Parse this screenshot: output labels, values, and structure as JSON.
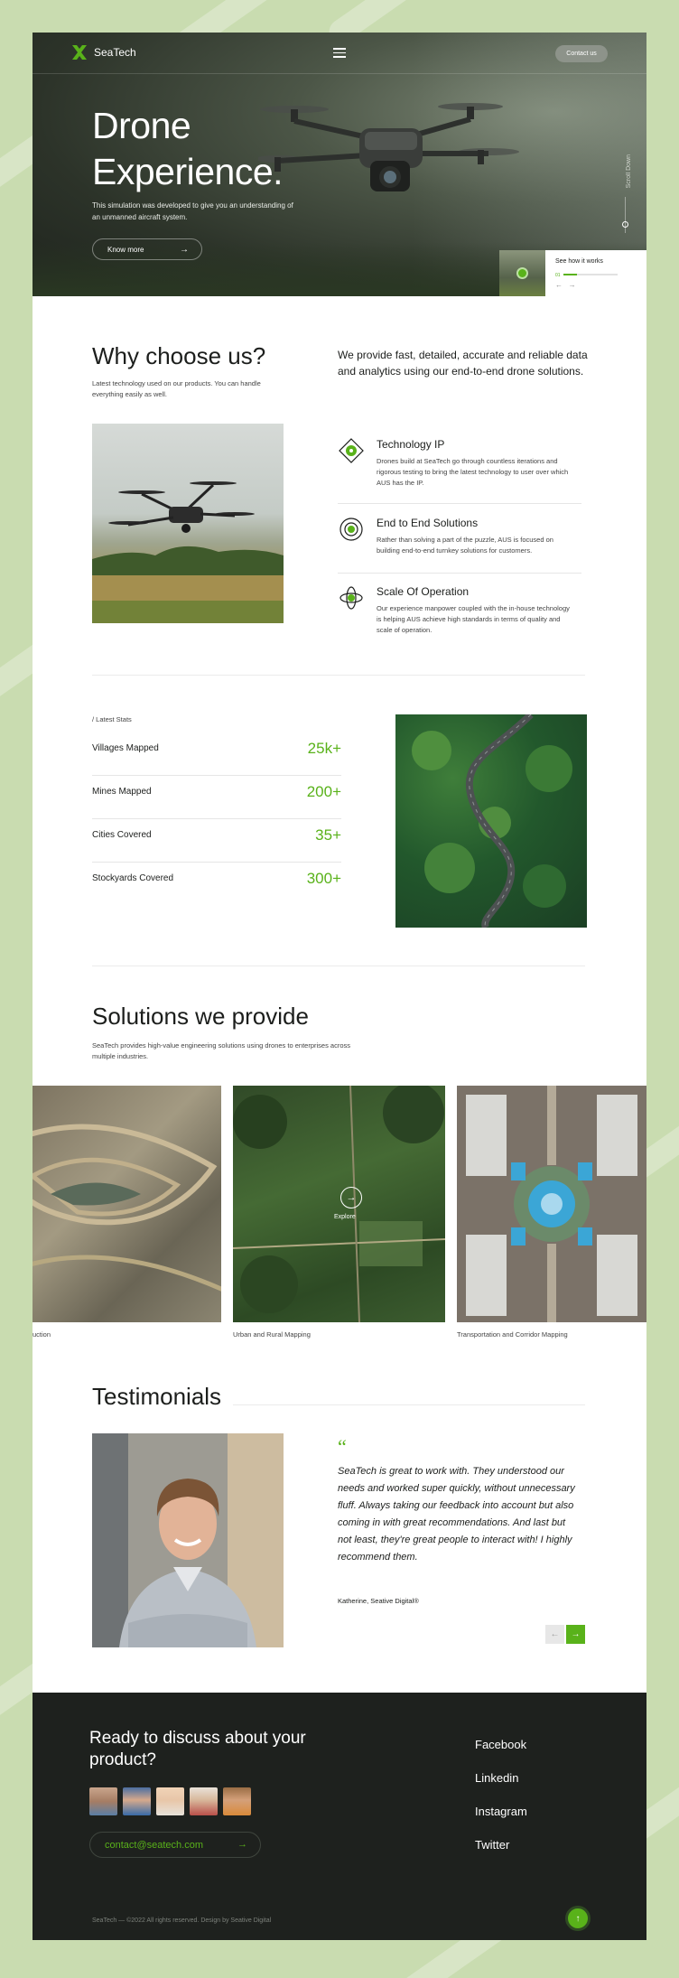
{
  "nav": {
    "brand": "SeaTech",
    "contact_label": "Contact us"
  },
  "hero": {
    "title_line1": "Drone",
    "title_line2": "Experience.",
    "description": "This simulation was developed to give you an understanding of an unmanned aircraft system.",
    "cta_label": "Know more",
    "scroll_label": "Scroll Down",
    "how_title": "See how it works",
    "how_progress_label": "01",
    "how_progress": 0.25
  },
  "why": {
    "heading": "Why choose us?",
    "subtext": "Latest technology used on our products. You can handle everything easily as well.",
    "lead": "We provide fast, detailed, accurate and reliable data and analytics using our end-to-end drone solutions.",
    "features": [
      {
        "title": "Technology IP",
        "text": "Drones build at SeaTech go through countless iterations and rigorous testing to bring the latest technology to user over which AUS has the IP."
      },
      {
        "title": "End to End Solutions",
        "text": "Rather than solving a part of the puzzle, AUS is focused on building end-to-end turnkey solutions for customers."
      },
      {
        "title": "Scale Of Operation",
        "text": "Our experience manpower coupled with the in-house technology is helping AUS achieve high standards in terms of quality and scale of operation."
      }
    ]
  },
  "stats": {
    "label": "/ Latest Stats",
    "items": [
      {
        "name": "Villages Mapped",
        "value": "25k+"
      },
      {
        "name": "Mines Mapped",
        "value": "200+"
      },
      {
        "name": "Cities Covered",
        "value": "35+"
      },
      {
        "name": "Stockyards Covered",
        "value": "300+"
      }
    ]
  },
  "solutions": {
    "heading": "Solutions we provide",
    "subtext": "SeaTech provides high-value engineering solutions using drones to enterprises across multiple industries.",
    "cards": [
      {
        "caption": "uction"
      },
      {
        "caption": "Urban and Rural Mapping",
        "explore_label": "Explore"
      },
      {
        "caption": "Transportation and Corridor Mapping"
      }
    ]
  },
  "testimonials": {
    "heading": "Testimonials",
    "quote_mark": "“",
    "quote": "SeaTech is great to work with. They understood our needs and worked super quickly, without unnecessary fluff. Always taking our feedback into account but also coming in with great recommendations. And last but not least, they're great people to interact with! I highly recommend them.",
    "author": "Katherine, Seative Digital®"
  },
  "footer": {
    "heading": "Ready to discuss about your product?",
    "email": "contact@seatech.com",
    "social": [
      "Facebook",
      "Linkedin",
      "Instagram",
      "Twitter"
    ],
    "copyright": "SeaTech — ©2022 All rights reserved. Design by Seative Digital"
  },
  "colors": {
    "accent": "#59b21a",
    "background": "#c9dcb0",
    "footer": "#1e211e"
  },
  "icons": [
    "logo-icon",
    "menu-icon",
    "arrow-right-icon",
    "play-icon",
    "technology-icon",
    "solutions-icon",
    "scale-icon",
    "arrow-left-icon",
    "arrow-up-icon"
  ]
}
